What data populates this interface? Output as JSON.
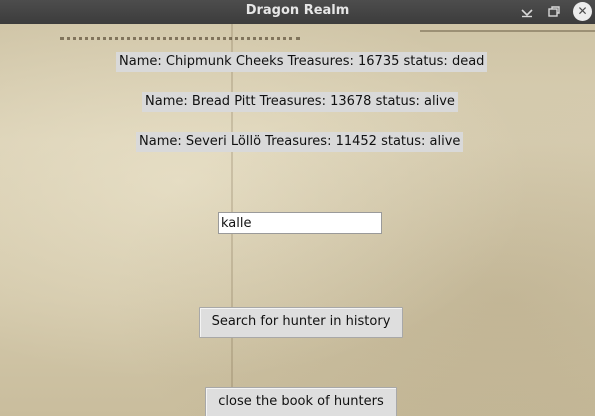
{
  "window": {
    "title": "Dragon Realm",
    "controls": {
      "minimize_icon": "chevron-down",
      "maximize_icon": "restore-window",
      "close_icon": "✕"
    }
  },
  "hunters": [
    {
      "text": "Name: Chipmunk Cheeks Treasures: 16735 status: dead"
    },
    {
      "text": "Name: Bread Pitt Treasures: 13678 status: alive"
    },
    {
      "text": "Name: Severi Löllö Treasures: 11452 status: alive"
    }
  ],
  "search": {
    "value": "kalle",
    "button_label": "Search for hunter in history"
  },
  "close_button_label": "close the book of hunters"
}
